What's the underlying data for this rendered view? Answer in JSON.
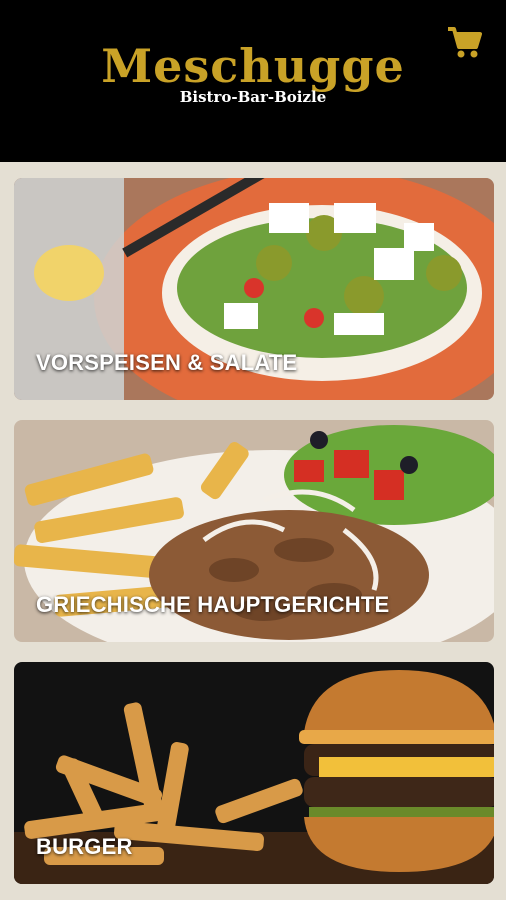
{
  "brand": {
    "name": "Meschugge",
    "tagline": "Bistro-Bar-Boizle",
    "accent_color": "#c9a227"
  },
  "header": {
    "cart_icon": "shopping-cart-icon"
  },
  "categories": [
    {
      "label": "VORSPEISEN & SALATE"
    },
    {
      "label": "GRIECHISCHE HAUPTGERICHTE"
    },
    {
      "label": "BURGER"
    }
  ]
}
